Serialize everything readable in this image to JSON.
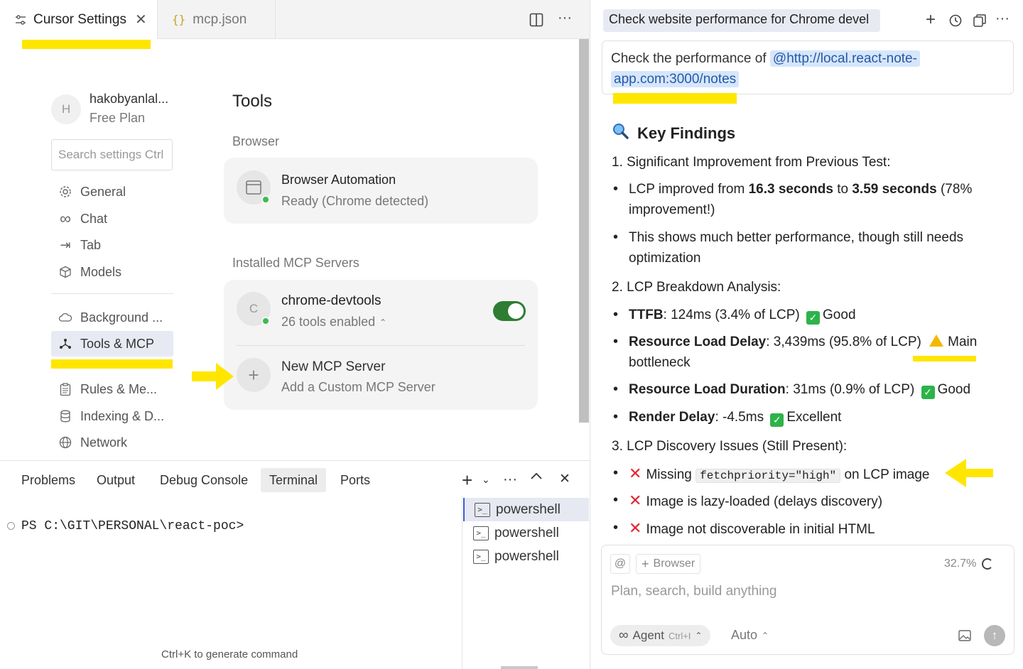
{
  "editor": {
    "tabs": [
      {
        "label": "Cursor Settings",
        "icon": "sliders-icon",
        "active": true
      },
      {
        "label": "mcp.json",
        "icon": "json-braces-icon",
        "active": false
      }
    ]
  },
  "settings": {
    "user": {
      "avatar_letter": "H",
      "name": "hakobyanlal...",
      "plan": "Free Plan"
    },
    "search_placeholder": "Search settings Ctrl",
    "nav_items": [
      {
        "label": "General",
        "icon": "gear-icon"
      },
      {
        "label": "Chat",
        "icon": "infinity-icon"
      },
      {
        "label": "Tab",
        "icon": "tab-arrow-icon"
      },
      {
        "label": "Models",
        "icon": "cube-icon"
      },
      {
        "label": "Background ...",
        "icon": "cloud-icon"
      },
      {
        "label": "Tools & MCP",
        "icon": "network-icon",
        "selected": true
      },
      {
        "label": "Rules & Me...",
        "icon": "clipboard-icon"
      },
      {
        "label": "Indexing & D...",
        "icon": "database-icon"
      },
      {
        "label": "Network",
        "icon": "globe-icon"
      }
    ],
    "section_title": "Tools",
    "browser_heading": "Browser",
    "browser_card": {
      "title": "Browser Automation",
      "subtitle": "Ready (Chrome detected)"
    },
    "mcp_heading": "Installed MCP Servers",
    "mcp_server": {
      "avatar_letter": "C",
      "name": "chrome-devtools",
      "tools": "26 tools enabled",
      "enabled": true
    },
    "new_server": {
      "title": "New MCP Server",
      "subtitle": "Add a Custom MCP Server"
    }
  },
  "panel": {
    "tabs": [
      "Problems",
      "Output",
      "Debug Console",
      "Terminal",
      "Ports"
    ],
    "selected_tab": "Terminal",
    "prompt": "PS C:\\GIT\\PERSONAL\\react-poc>",
    "hint": "Ctrl+K to generate command",
    "shells": [
      "powershell",
      "powershell",
      "powershell"
    ]
  },
  "chat": {
    "title": "Check website performance for Chrome devel",
    "user_message_prefix": "Check the performance of",
    "user_message_mention_1": "@http://local.react-note-",
    "user_message_mention_2": "app.com:3000/notes",
    "findings_title": "Key Findings",
    "section1": "1. Significant Improvement from Previous Test:",
    "s1_b1_pre": "LCP improved from ",
    "s1_b1_v1": "16.3 seconds",
    "s1_b1_mid": " to ",
    "s1_b1_v2": "3.59 seconds",
    "s1_b1_post": " (78%",
    "s1_b1_line2": "improvement!)",
    "s1_b2_line1": "This shows much better performance, though still needs",
    "s1_b2_line2": "optimization",
    "section2": "2. LCP Breakdown Analysis:",
    "ttfb_label": "TTFB",
    "ttfb_value": ": 124ms (3.4% of LCP)",
    "ttfb_status": "Good",
    "rld_label": "Resource Load Delay",
    "rld_value": ": 3,439ms (95.8% of LCP)",
    "rld_status_1": "Main",
    "rld_status_2": "bottleneck",
    "rldur_label": "Resource Load Duration",
    "rldur_value": ": 31ms (0.9% of LCP)",
    "rldur_status": "Good",
    "rd_label": "Render Delay",
    "rd_value": ": -4.5ms",
    "rd_status": "Excellent",
    "section3": "3. LCP Discovery Issues (Still Present):",
    "issue1_pre": "Missing",
    "issue1_code": "fetchpriority=\"high\"",
    "issue1_post": "on LCP image",
    "issue2": "Image is lazy-loaded (delays discovery)",
    "issue3": "Image not discoverable in initial HTML",
    "composer": {
      "at_symbol": "@",
      "browser_chip": "Browser",
      "context_usage": "32.7%",
      "placeholder": "Plan, search, build anything",
      "mode": "Agent",
      "mode_shortcut": "Ctrl+I",
      "model": "Auto"
    }
  }
}
